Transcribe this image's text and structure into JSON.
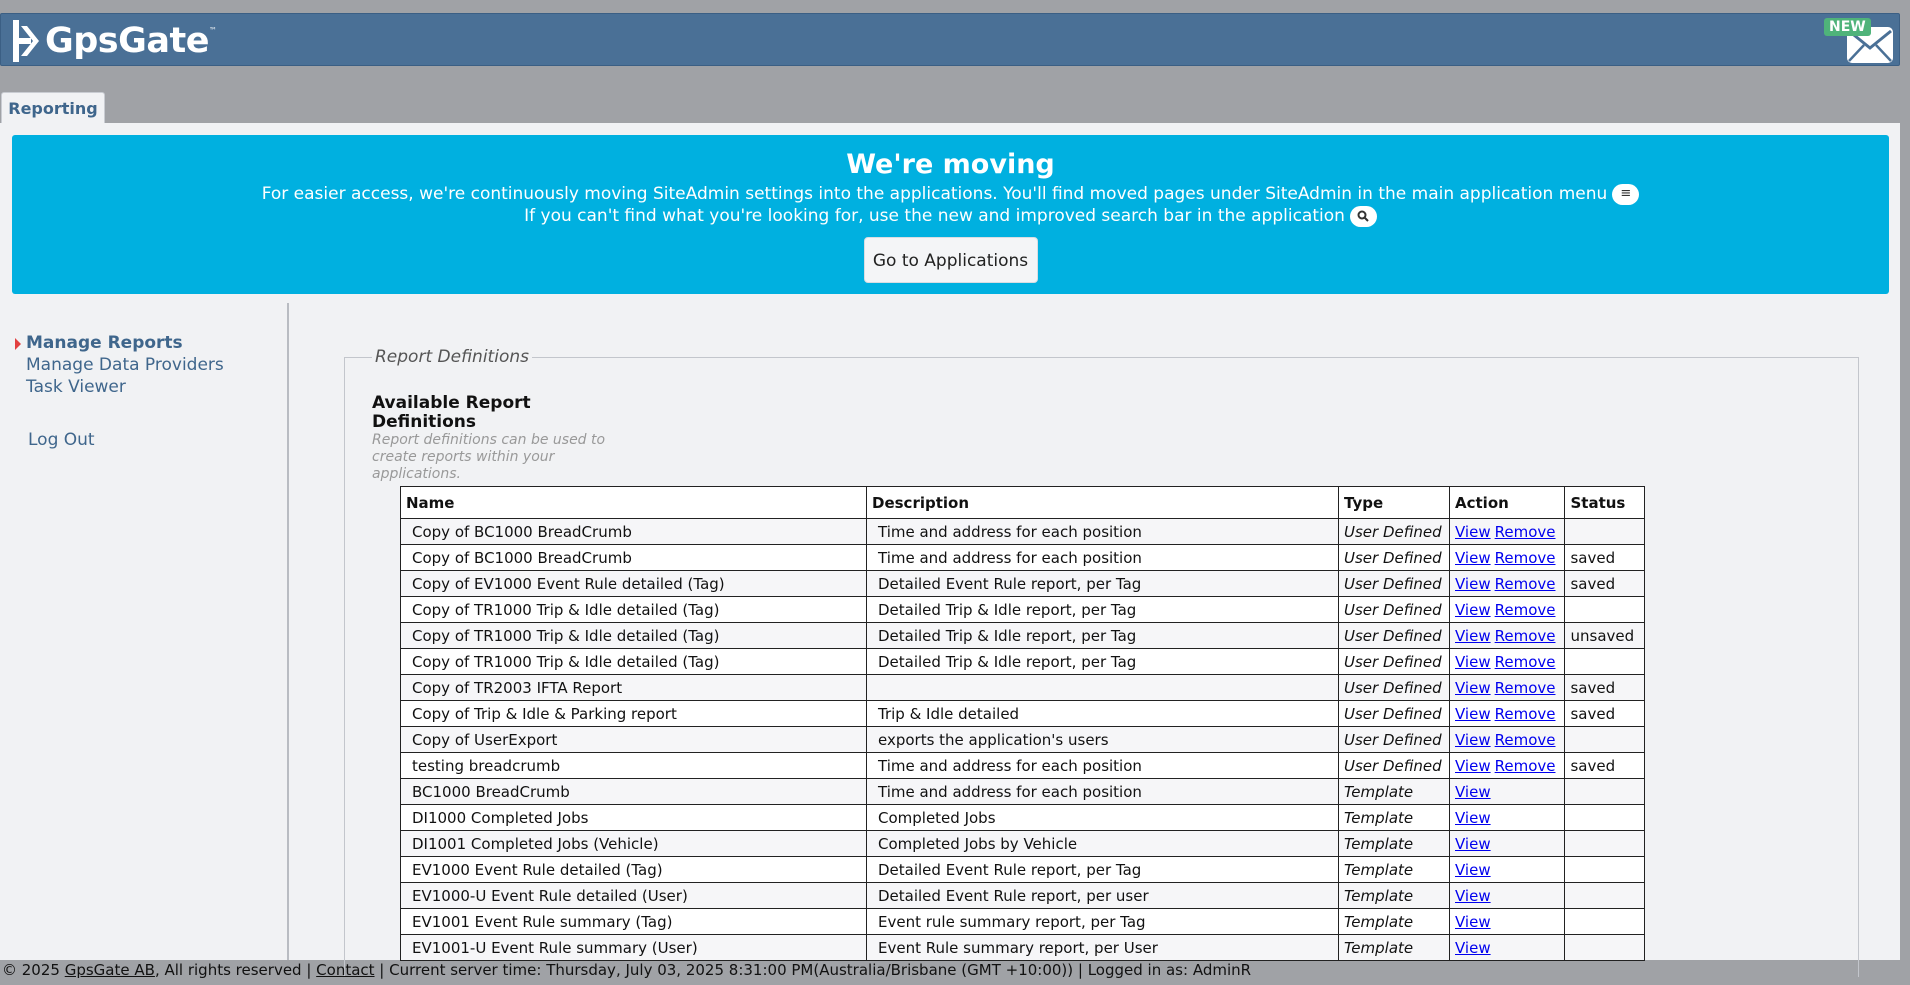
{
  "brand": {
    "name": "GpsGate",
    "tm": "™"
  },
  "mail": {
    "badge": "NEW"
  },
  "tab": {
    "label": "Reporting"
  },
  "banner": {
    "title": "We're moving",
    "line1": "For easier access, we're continuously moving SiteAdmin settings into the applications. You'll find moved pages under SiteAdmin in the main application menu",
    "line2": "If you can't find what you're looking for, use the new and improved search bar in the application",
    "button": "Go to Applications"
  },
  "sidebar": {
    "manage_reports": "Manage Reports",
    "manage_data_providers": "Manage Data Providers",
    "task_viewer": "Task Viewer",
    "log_out": "Log Out"
  },
  "section": {
    "legend": "Report Definitions",
    "heading": "Available Report Definitions",
    "subtext": "Report definitions can be used to create reports within your applications."
  },
  "table": {
    "columns": [
      "Name",
      "Description",
      "Type",
      "Action",
      "Status"
    ],
    "view_label": "View",
    "remove_label": "Remove",
    "rows": [
      {
        "name": "Copy of BC1000 BreadCrumb",
        "desc": "Time and address for each position",
        "type": "User Defined",
        "remove": true,
        "status": ""
      },
      {
        "name": "Copy of BC1000 BreadCrumb",
        "desc": "Time and address for each position",
        "type": "User Defined",
        "remove": true,
        "status": "saved"
      },
      {
        "name": "Copy of EV1000 Event Rule detailed (Tag)",
        "desc": "Detailed Event Rule report, per Tag",
        "type": "User Defined",
        "remove": true,
        "status": "saved"
      },
      {
        "name": "Copy of TR1000 Trip & Idle detailed (Tag)",
        "desc": "Detailed Trip & Idle report, per Tag",
        "type": "User Defined",
        "remove": true,
        "status": ""
      },
      {
        "name": "Copy of TR1000 Trip & Idle detailed (Tag)",
        "desc": "Detailed Trip & Idle report, per Tag",
        "type": "User Defined",
        "remove": true,
        "status": "unsaved"
      },
      {
        "name": "Copy of TR1000 Trip & Idle detailed (Tag)",
        "desc": "Detailed Trip & Idle report, per Tag",
        "type": "User Defined",
        "remove": true,
        "status": ""
      },
      {
        "name": "Copy of TR2003 IFTA Report",
        "desc": "",
        "type": "User Defined",
        "remove": true,
        "status": "saved"
      },
      {
        "name": "Copy of Trip & Idle & Parking report",
        "desc": "Trip & Idle detailed",
        "type": "User Defined",
        "remove": true,
        "status": "saved"
      },
      {
        "name": "Copy of UserExport",
        "desc": "exports the application's users",
        "type": "User Defined",
        "remove": true,
        "status": ""
      },
      {
        "name": "testing breadcrumb",
        "desc": "Time and address for each position",
        "type": "User Defined",
        "remove": true,
        "status": "saved"
      },
      {
        "name": "BC1000 BreadCrumb",
        "desc": "Time and address for each position",
        "type": "Template",
        "remove": false,
        "status": ""
      },
      {
        "name": "DI1000 Completed Jobs",
        "desc": "Completed Jobs",
        "type": "Template",
        "remove": false,
        "status": ""
      },
      {
        "name": "DI1001 Completed Jobs (Vehicle)",
        "desc": "Completed Jobs by Vehicle",
        "type": "Template",
        "remove": false,
        "status": ""
      },
      {
        "name": "EV1000 Event Rule detailed (Tag)",
        "desc": "Detailed Event Rule report, per Tag",
        "type": "Template",
        "remove": false,
        "status": ""
      },
      {
        "name": "EV1000-U Event Rule detailed (User)",
        "desc": "Detailed Event Rule report, per user",
        "type": "Template",
        "remove": false,
        "status": ""
      },
      {
        "name": "EV1001 Event Rule summary (Tag)",
        "desc": "Event rule summary report, per Tag",
        "type": "Template",
        "remove": false,
        "status": ""
      },
      {
        "name": "EV1001-U Event Rule summary (User)",
        "desc": "Event Rule summary report, per User",
        "type": "Template",
        "remove": false,
        "status": ""
      }
    ]
  },
  "footer": {
    "copyright": "© 2025 ",
    "company": "GpsGate AB",
    "rights": ", All rights reserved | ",
    "contact": "Contact",
    "rest": " | Current server time: Thursday, July 03, 2025 8:31:00 PM(Australia/Brisbane (GMT +10:00)) | Logged in as: AdminR"
  }
}
